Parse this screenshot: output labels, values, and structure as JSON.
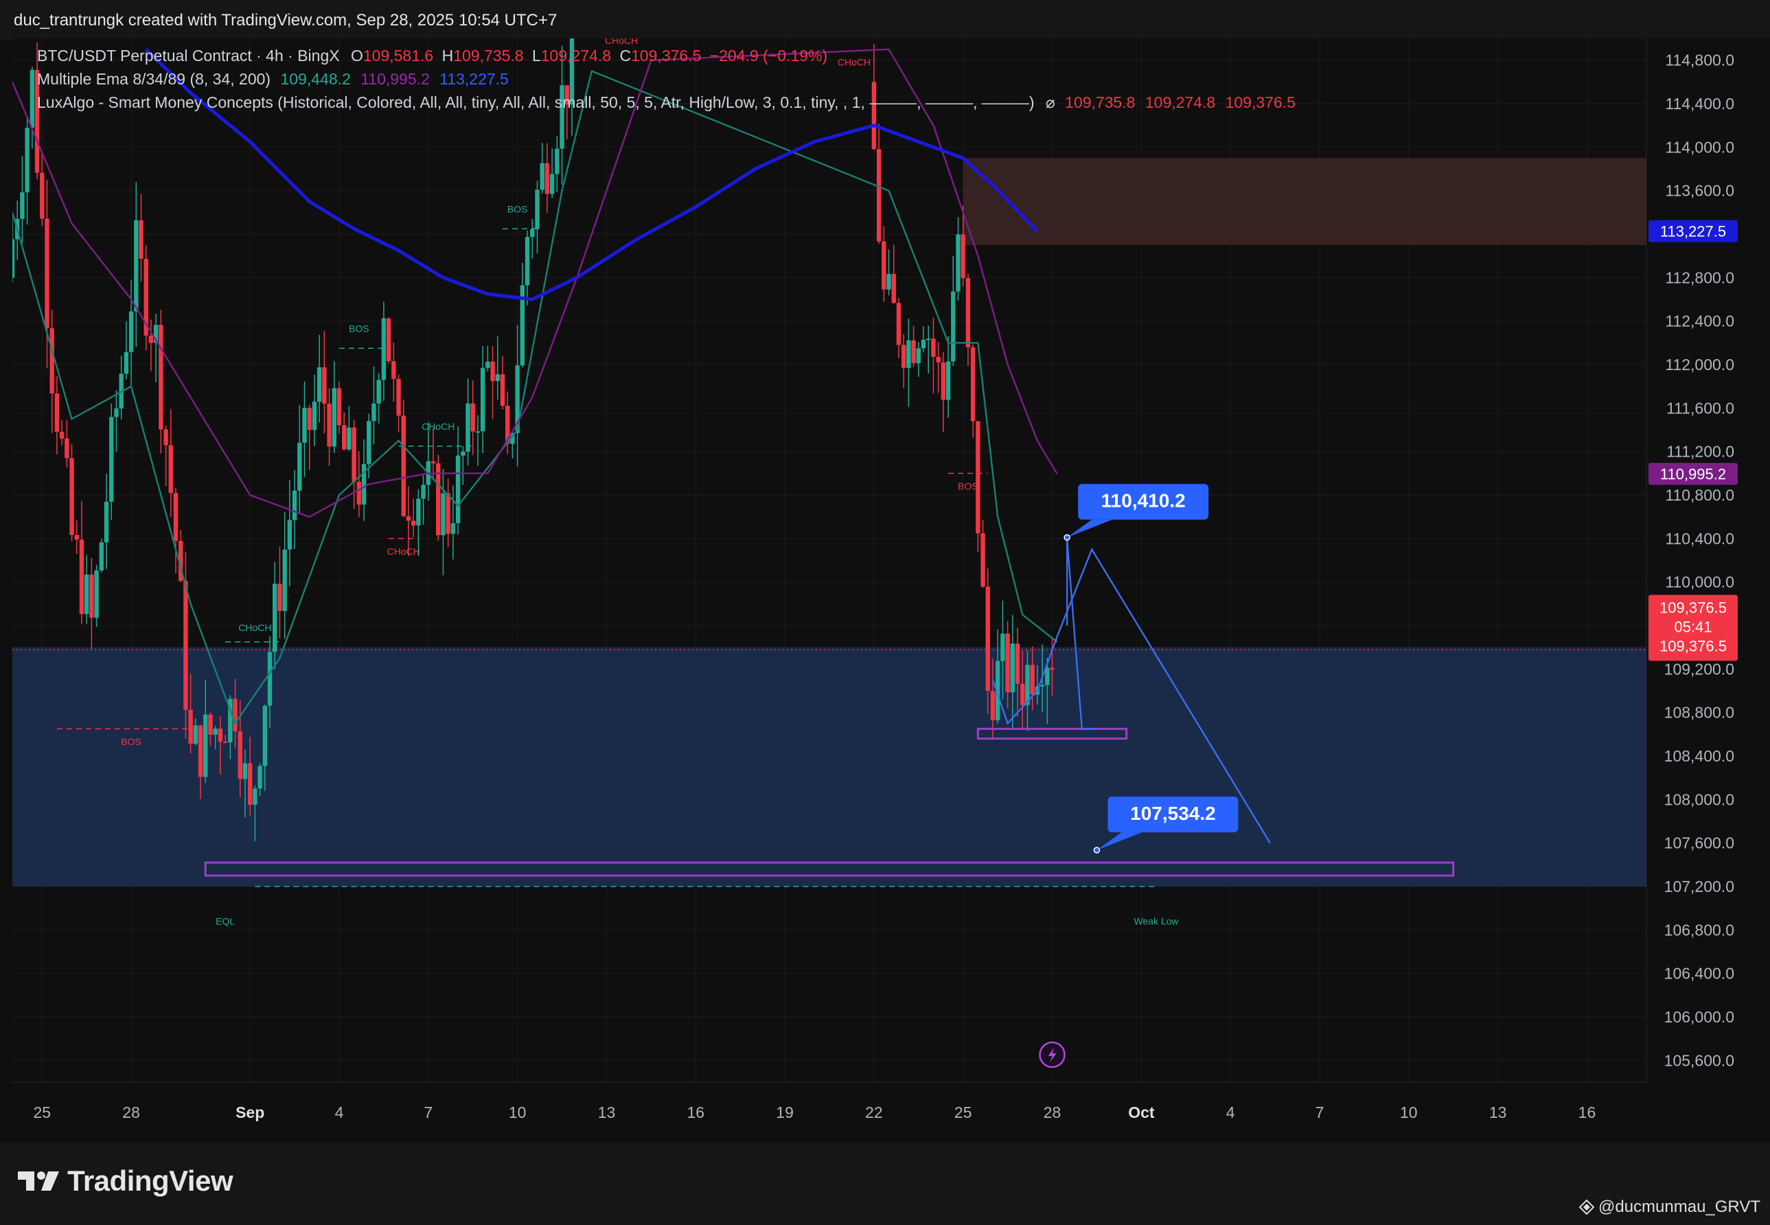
{
  "header": {
    "text": "duc_trantrungk created with TradingView.com, Sep 28, 2025 10:54 UTC+7"
  },
  "legend": {
    "symbol": "BTC/USDT Perpetual Contract · 4h · BingX",
    "open_label": "O",
    "open": "109,581.6",
    "high_label": "H",
    "high": "109,735.8",
    "low_label": "L",
    "low": "109,274.8",
    "close_label": "C",
    "close": "109,376.5",
    "change": "−204.9 (−0.19%)",
    "ema_name": "Multiple Ema 8/34/89 (8, 34, 200)",
    "ema8": "109,448.2",
    "ema34": "110,995.2",
    "ema200": "113,227.5",
    "lux_name": "LuxAlgo - Smart Money Concepts (Historical, Colored, All, All, tiny, All, All, small, 50, 5, 5, Atr, High/Low, 3, 0.1, tiny, , 1, ———, ———, ———)",
    "lux_symbol": "⌀",
    "lux_v1": "109,735.8",
    "lux_v2": "109,274.8",
    "lux_v3": "109,376.5"
  },
  "colors": {
    "up": "#22ab94",
    "down": "#f23645",
    "ema8": "#1b7f73",
    "ema34": "#7b1f86",
    "ema200": "#1a1adb",
    "demand_zone": "#1b2c4d",
    "supply_zone": "#3a2424",
    "projection": "#3d6cf0",
    "box_outline": "#9b3fc4",
    "callout": "#2962ff"
  },
  "chart_data": {
    "type": "candlestick",
    "title": "BTC/USDT Perpetual Contract · 4h · BingX",
    "ylim": [
      105400,
      115000
    ],
    "y_ticks": [
      105600,
      106000,
      106400,
      106800,
      107200,
      107600,
      108000,
      108400,
      108800,
      109200,
      109600,
      110000,
      110400,
      110800,
      111200,
      111600,
      112000,
      112400,
      112800,
      113200,
      113600,
      114000,
      114400,
      114800
    ],
    "y_tick_labels": [
      "105,600.0",
      "106,000.0",
      "106,400.0",
      "106,800.0",
      "107,200.0",
      "107,600.0",
      "108,000.0",
      "108,400.0",
      "108,800.0",
      "109,200.0",
      "109,600.0",
      "110,000.0",
      "110,400.0",
      "110,800.0",
      "111,200.0",
      "111,600.0",
      "112,000.0",
      "112,400.0",
      "112,800.0",
      "113,200.0",
      "113,600.0",
      "114,000.0",
      "114,400.0",
      "114,800.0"
    ],
    "x_start": "2025-08-24",
    "x_end": "2025-10-18",
    "x_ticks": [
      {
        "date": "2025-08-25",
        "label": "25",
        "bold": false
      },
      {
        "date": "2025-08-28",
        "label": "28",
        "bold": false
      },
      {
        "date": "2025-09-01",
        "label": "Sep",
        "bold": true
      },
      {
        "date": "2025-09-04",
        "label": "4",
        "bold": false
      },
      {
        "date": "2025-09-07",
        "label": "7",
        "bold": false
      },
      {
        "date": "2025-09-10",
        "label": "10",
        "bold": false
      },
      {
        "date": "2025-09-13",
        "label": "13",
        "bold": false
      },
      {
        "date": "2025-09-16",
        "label": "16",
        "bold": false
      },
      {
        "date": "2025-09-19",
        "label": "19",
        "bold": false
      },
      {
        "date": "2025-09-22",
        "label": "22",
        "bold": false
      },
      {
        "date": "2025-09-25",
        "label": "25",
        "bold": false
      },
      {
        "date": "2025-09-28",
        "label": "28",
        "bold": false
      },
      {
        "date": "2025-10-01",
        "label": "Oct",
        "bold": true
      },
      {
        "date": "2025-10-04",
        "label": "4",
        "bold": false
      },
      {
        "date": "2025-10-07",
        "label": "7",
        "bold": false
      },
      {
        "date": "2025-10-10",
        "label": "10",
        "bold": false
      },
      {
        "date": "2025-10-13",
        "label": "13",
        "bold": false
      },
      {
        "date": "2025-10-16",
        "label": "16",
        "bold": false
      }
    ],
    "price_path": [
      {
        "date": "2025-08-24T00:00",
        "price": 112800
      },
      {
        "date": "2025-08-24T20:00",
        "price": 114600
      },
      {
        "date": "2025-08-25T12:00",
        "price": 112000
      },
      {
        "date": "2025-08-26T04:00",
        "price": 110400
      },
      {
        "date": "2025-08-26T20:00",
        "price": 109600
      },
      {
        "date": "2025-08-27T16:00",
        "price": 111600
      },
      {
        "date": "2025-08-28T08:00",
        "price": 113000
      },
      {
        "date": "2025-08-29T00:00",
        "price": 112200
      },
      {
        "date": "2025-08-29T16:00",
        "price": 110400
      },
      {
        "date": "2025-08-30T04:00",
        "price": 108400
      },
      {
        "date": "2025-08-30T20:00",
        "price": 108600
      },
      {
        "date": "2025-08-31T16:00",
        "price": 108900
      },
      {
        "date": "2025-09-01T04:00",
        "price": 107800
      },
      {
        "date": "2025-09-01T20:00",
        "price": 109400
      },
      {
        "date": "2025-09-02T16:00",
        "price": 110900
      },
      {
        "date": "2025-09-03T12:00",
        "price": 111800
      },
      {
        "date": "2025-09-04T08:00",
        "price": 111200
      },
      {
        "date": "2025-09-05T00:00",
        "price": 110800
      },
      {
        "date": "2025-09-05T16:00",
        "price": 112600
      },
      {
        "date": "2025-09-06T08:00",
        "price": 110800
      },
      {
        "date": "2025-09-07T00:00",
        "price": 110900
      },
      {
        "date": "2025-09-07T20:00",
        "price": 110600
      },
      {
        "date": "2025-09-08T16:00",
        "price": 111500
      },
      {
        "date": "2025-09-09T08:00",
        "price": 112100
      },
      {
        "date": "2025-09-09T20:00",
        "price": 111000
      },
      {
        "date": "2025-09-10T12:00",
        "price": 113200
      },
      {
        "date": "2025-09-11T08:00",
        "price": 114100
      },
      {
        "date": "2025-09-12T00:00",
        "price": 114800
      },
      {
        "date": "2025-09-22T00:00",
        "price": 114600
      },
      {
        "date": "2025-09-22T12:00",
        "price": 112600
      },
      {
        "date": "2025-09-23T08:00",
        "price": 112200
      },
      {
        "date": "2025-09-23T20:00",
        "price": 112500
      },
      {
        "date": "2025-09-24T12:00",
        "price": 111700
      },
      {
        "date": "2025-09-25T00:00",
        "price": 113200
      },
      {
        "date": "2025-09-25T08:00",
        "price": 112000
      },
      {
        "date": "2025-09-25T16:00",
        "price": 110600
      },
      {
        "date": "2025-09-26T00:00",
        "price": 109000
      },
      {
        "date": "2025-09-26T12:00",
        "price": 109200
      },
      {
        "date": "2025-09-27T04:00",
        "price": 109100
      },
      {
        "date": "2025-09-27T20:00",
        "price": 109400
      },
      {
        "date": "2025-09-28T04:00",
        "price": 109376.5
      }
    ],
    "series": [
      {
        "name": "EMA 8",
        "color": "#1b7f73",
        "points": [
          {
            "date": "2025-08-24T00:00",
            "price": 113400
          },
          {
            "date": "2025-08-26T00:00",
            "price": 111500
          },
          {
            "date": "2025-08-28T00:00",
            "price": 111800
          },
          {
            "date": "2025-08-30T00:00",
            "price": 109800
          },
          {
            "date": "2025-08-31T12:00",
            "price": 108700
          },
          {
            "date": "2025-09-02T00:00",
            "price": 109300
          },
          {
            "date": "2025-09-04T00:00",
            "price": 110800
          },
          {
            "date": "2025-09-06T00:00",
            "price": 111300
          },
          {
            "date": "2025-09-08T00:00",
            "price": 110700
          },
          {
            "date": "2025-09-10T00:00",
            "price": 111400
          },
          {
            "date": "2025-09-11T12:00",
            "price": 113600
          },
          {
            "date": "2025-09-12T12:00",
            "price": 114700
          },
          {
            "date": "2025-09-22T12:00",
            "price": 113600
          },
          {
            "date": "2025-09-24T12:00",
            "price": 112200
          },
          {
            "date": "2025-09-25T12:00",
            "price": 112200
          },
          {
            "date": "2025-09-26T04:00",
            "price": 110600
          },
          {
            "date": "2025-09-27T00:00",
            "price": 109700
          },
          {
            "date": "2025-09-28T04:00",
            "price": 109448.2
          }
        ]
      },
      {
        "name": "EMA 34",
        "color": "#7b1f86",
        "points": [
          {
            "date": "2025-08-24T00:00",
            "price": 114600
          },
          {
            "date": "2025-08-26T00:00",
            "price": 113300
          },
          {
            "date": "2025-08-28T00:00",
            "price": 112600
          },
          {
            "date": "2025-08-30T00:00",
            "price": 111700
          },
          {
            "date": "2025-09-01T00:00",
            "price": 110800
          },
          {
            "date": "2025-09-03T00:00",
            "price": 110600
          },
          {
            "date": "2025-09-05T00:00",
            "price": 110900
          },
          {
            "date": "2025-09-07T00:00",
            "price": 111000
          },
          {
            "date": "2025-09-09T00:00",
            "price": 111000
          },
          {
            "date": "2025-09-10T12:00",
            "price": 111700
          },
          {
            "date": "2025-09-12T00:00",
            "price": 112800
          },
          {
            "date": "2025-09-13T12:00",
            "price": 114000
          },
          {
            "date": "2025-09-14T12:00",
            "price": 114800
          },
          {
            "date": "2025-09-22T12:00",
            "price": 114900
          },
          {
            "date": "2025-09-24T00:00",
            "price": 114200
          },
          {
            "date": "2025-09-25T12:00",
            "price": 113000
          },
          {
            "date": "2025-09-26T12:00",
            "price": 112000
          },
          {
            "date": "2025-09-27T12:00",
            "price": 111300
          },
          {
            "date": "2025-09-28T04:00",
            "price": 110995.2
          }
        ]
      },
      {
        "name": "EMA 200",
        "color": "#1a1adb",
        "points": [
          {
            "date": "2025-08-28T12:00",
            "price": 114900
          },
          {
            "date": "2025-08-30T00:00",
            "price": 114500
          },
          {
            "date": "2025-09-01T00:00",
            "price": 114050
          },
          {
            "date": "2025-09-03T00:00",
            "price": 113500
          },
          {
            "date": "2025-09-04T12:00",
            "price": 113250
          },
          {
            "date": "2025-09-06T00:00",
            "price": 113050
          },
          {
            "date": "2025-09-07T12:00",
            "price": 112800
          },
          {
            "date": "2025-09-09T00:00",
            "price": 112650
          },
          {
            "date": "2025-09-10T12:00",
            "price": 112600
          },
          {
            "date": "2025-09-12T00:00",
            "price": 112800
          },
          {
            "date": "2025-09-14T00:00",
            "price": 113150
          },
          {
            "date": "2025-09-16T00:00",
            "price": 113450
          },
          {
            "date": "2025-09-18T00:00",
            "price": 113800
          },
          {
            "date": "2025-09-20T00:00",
            "price": 114050
          },
          {
            "date": "2025-09-22T00:00",
            "price": 114200
          },
          {
            "date": "2025-09-23T12:00",
            "price": 114050
          },
          {
            "date": "2025-09-25T00:00",
            "price": 113900
          },
          {
            "date": "2025-09-26T00:00",
            "price": 113650
          },
          {
            "date": "2025-09-27T12:00",
            "price": 113227.5
          }
        ]
      }
    ],
    "zones": [
      {
        "kind": "supply",
        "x0": "2025-09-25T00:00",
        "x1": "2025-10-19T00:00",
        "y0": 113100,
        "y1": 113900
      },
      {
        "kind": "demand",
        "x0": "2025-08-24T00:00",
        "x1": "2025-10-19T00:00",
        "y0": 107200,
        "y1": 109400
      }
    ],
    "boxes": [
      {
        "x0": "2025-08-30T12:00",
        "x1": "2025-10-11T12:00",
        "y0": 107300,
        "y1": 107420
      },
      {
        "x0": "2025-09-25T12:00",
        "x1": "2025-09-30T12:00",
        "y0": 108560,
        "y1": 108650
      }
    ],
    "smc_markers": [
      {
        "label": "BOS",
        "color": "down",
        "date": "2025-08-28T00:00",
        "price": 108500,
        "line_x0": "2025-08-25T12:00",
        "line_x1": "2025-08-30T00:00",
        "line_y": 108650
      },
      {
        "label": "EQL",
        "color": "up",
        "date": "2025-08-31T04:00",
        "price": 106850
      },
      {
        "label": "CHoCH",
        "color": "up",
        "date": "2025-09-01T04:00",
        "price": 109550,
        "line_x0": "2025-08-31T04:00",
        "line_x1": "2025-09-02T00:00",
        "line_y": 109450
      },
      {
        "label": "BOS",
        "color": "up",
        "date": "2025-09-04T16:00",
        "price": 112300,
        "line_x0": "2025-09-04T00:00",
        "line_x1": "2025-09-05T12:00",
        "line_y": 112150
      },
      {
        "label": "CHoCH",
        "color": "down",
        "date": "2025-09-06T04:00",
        "price": 110250,
        "line_x0": "2025-09-05T16:00",
        "line_x1": "2025-09-06T16:00",
        "line_y": 110400
      },
      {
        "label": "CHoCH",
        "color": "up",
        "date": "2025-09-07T08:00",
        "price": 111400,
        "line_x0": "2025-09-06T00:00",
        "line_x1": "2025-09-08T12:00",
        "line_y": 111250
      },
      {
        "label": "BOS",
        "color": "up",
        "date": "2025-09-10T00:00",
        "price": 113400,
        "line_x0": "2025-09-09T12:00",
        "line_x1": "2025-09-10T16:00",
        "line_y": 113250
      },
      {
        "label": "CHoCH",
        "color": "down",
        "date": "2025-09-13T12:00",
        "price": 114950
      },
      {
        "label": "CHoCH",
        "color": "down",
        "date": "2025-09-21T08:00",
        "price": 114750
      },
      {
        "label": "BOS",
        "color": "down",
        "date": "2025-09-25T04:00",
        "price": 110850,
        "line_x0": "2025-09-24T12:00",
        "line_x1": "2025-09-25T20:00",
        "line_y": 111000
      },
      {
        "label": "Weak Low",
        "color": "up",
        "date": "2025-10-01T12:00",
        "price": 106850,
        "line_x0": "2025-09-01T04:00",
        "line_x1": "2025-10-01T12:00",
        "line_y": 107200
      }
    ],
    "projection_path": [
      {
        "date": "2025-09-26T00:00",
        "price": 109100
      },
      {
        "date": "2025-09-26T12:00",
        "price": 108700
      },
      {
        "date": "2025-09-27T12:00",
        "price": 109000
      },
      {
        "date": "2025-09-28T04:00",
        "price": 109500
      },
      {
        "date": "2025-09-29T08:00",
        "price": 110300
      },
      {
        "date": "2025-10-05T08:00",
        "price": 107600
      }
    ],
    "spike_path": [
      {
        "date": "2025-09-28T12:00",
        "price": 109600
      },
      {
        "date": "2025-09-28T12:00",
        "price": 110400
      },
      {
        "date": "2025-09-29T00:00",
        "price": 108650
      },
      {
        "date": "2025-09-29T12:00",
        "price": 108650
      }
    ],
    "callouts": [
      {
        "label": "110,410.2",
        "date": "2025-09-28T12:00",
        "price": 110410.2
      },
      {
        "label": "107,534.2",
        "date": "2025-09-29T12:00",
        "price": 107534.2
      }
    ],
    "current_price_line": 109376.5,
    "axis_labels": [
      {
        "label": "113,227.5",
        "price": 113227.5,
        "bg": "#1a1adb",
        "fg": "#ffffff"
      },
      {
        "label": "110,995.2",
        "price": 110995.2,
        "bg": "#7b1f86",
        "fg": "#ffffff"
      },
      {
        "label": "109,448.2",
        "price": 109448.2,
        "bg": "#1b7f73",
        "fg": "#ffffff"
      }
    ],
    "price_tag": {
      "price": 109376.5,
      "lines": [
        "109,376.5",
        "05:41",
        "109,376.5"
      ]
    },
    "flash_icon_date": "2025-09-28T00:00"
  },
  "footer": {
    "brand": "TradingView",
    "credit": "@ducmunmau_GRVT"
  }
}
